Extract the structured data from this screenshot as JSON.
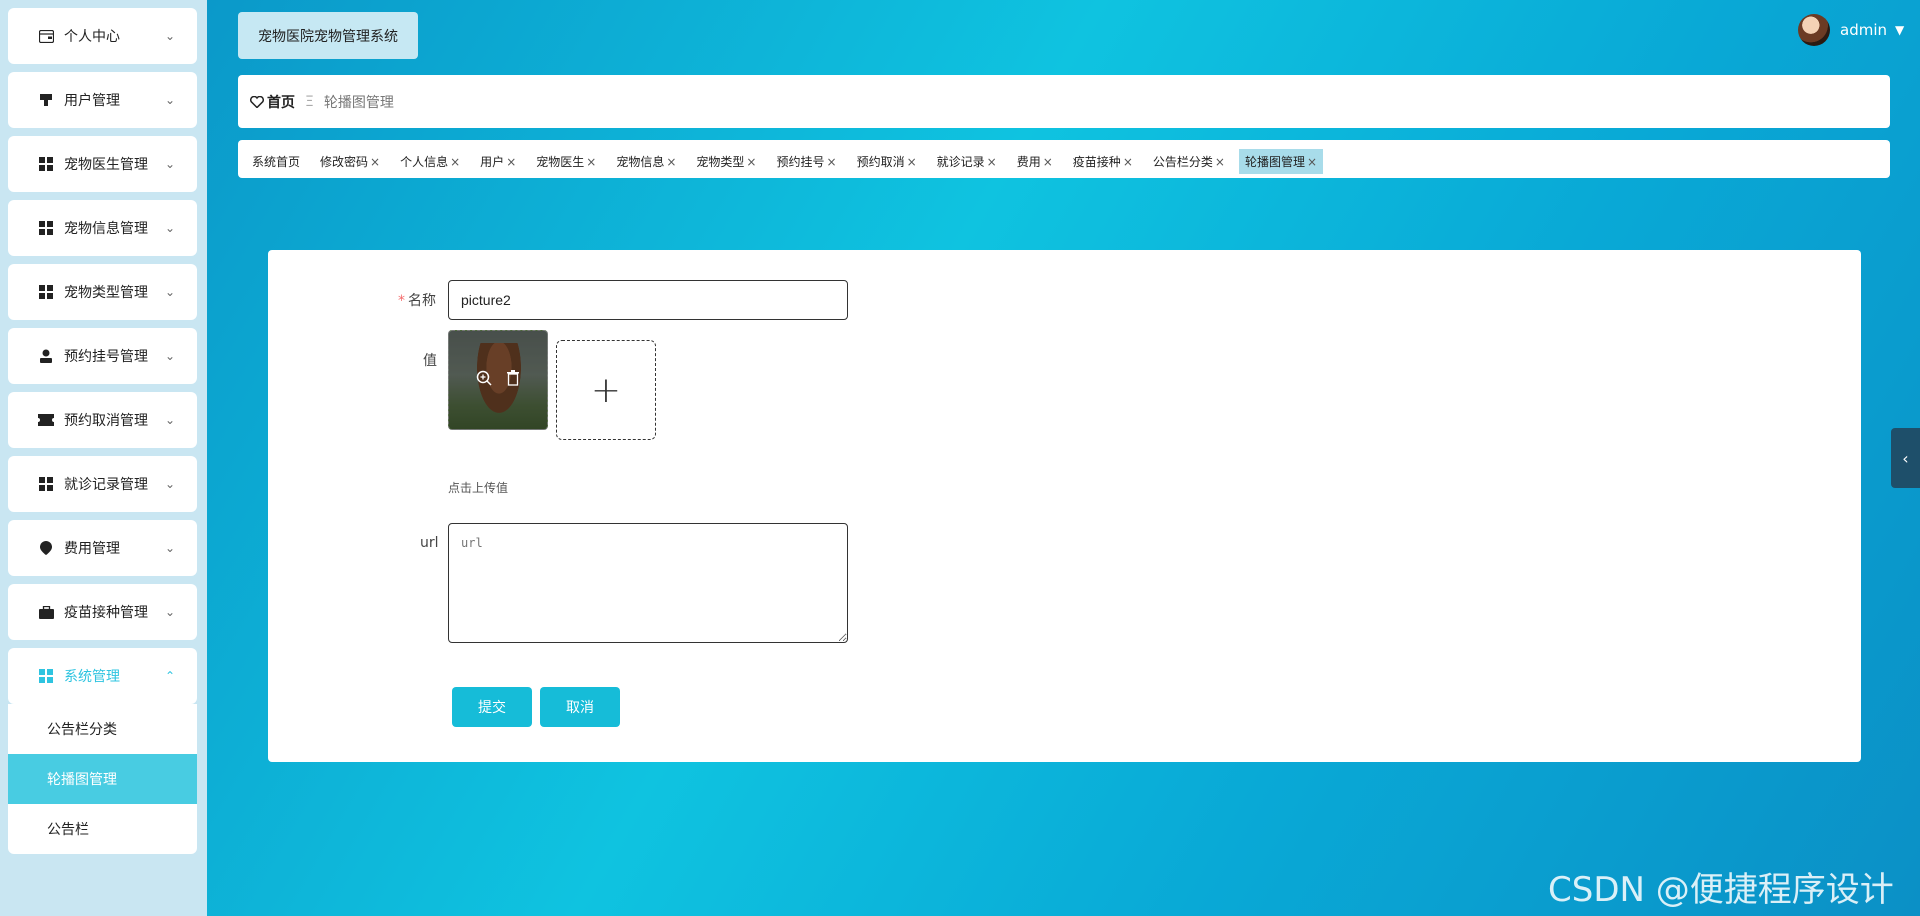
{
  "app": {
    "title": "宠物医院宠物管理系统"
  },
  "user": {
    "name": "admin",
    "caret": "▼"
  },
  "breadcrumb": {
    "home": "首页",
    "separator": "Ξ",
    "current": "轮播图管理"
  },
  "sidebar": {
    "items": [
      {
        "label": "个人中心",
        "icon": "wallet-icon"
      },
      {
        "label": "用户管理",
        "icon": "stamp-icon"
      },
      {
        "label": "宠物医生管理",
        "icon": "grid-icon"
      },
      {
        "label": "宠物信息管理",
        "icon": "grid-icon"
      },
      {
        "label": "宠物类型管理",
        "icon": "grid-icon"
      },
      {
        "label": "预约挂号管理",
        "icon": "person-icon"
      },
      {
        "label": "预约取消管理",
        "icon": "ticket-icon"
      },
      {
        "label": "就诊记录管理",
        "icon": "grid-icon"
      },
      {
        "label": "费用管理",
        "icon": "location-icon"
      },
      {
        "label": "疫苗接种管理",
        "icon": "briefcase-icon"
      },
      {
        "label": "系统管理",
        "icon": "grid-icon"
      }
    ],
    "submenu": [
      {
        "label": "公告栏分类"
      },
      {
        "label": "轮播图管理"
      },
      {
        "label": "公告栏"
      }
    ]
  },
  "tabs": [
    {
      "label": "系统首页",
      "closable": false
    },
    {
      "label": "修改密码",
      "closable": true
    },
    {
      "label": "个人信息",
      "closable": true
    },
    {
      "label": "用户",
      "closable": true
    },
    {
      "label": "宠物医生",
      "closable": true
    },
    {
      "label": "宠物信息",
      "closable": true
    },
    {
      "label": "宠物类型",
      "closable": true
    },
    {
      "label": "预约挂号",
      "closable": true
    },
    {
      "label": "预约取消",
      "closable": true
    },
    {
      "label": "就诊记录",
      "closable": true
    },
    {
      "label": "费用",
      "closable": true
    },
    {
      "label": "疫苗接种",
      "closable": true
    },
    {
      "label": "公告栏分类",
      "closable": true
    },
    {
      "label": "轮播图管理",
      "closable": true
    }
  ],
  "form": {
    "name_label": "名称",
    "name_required": "*",
    "name_value": "picture2",
    "value_label": "值",
    "upload_plus": "+",
    "upload_hint": "点击上传值",
    "url_label": "url",
    "url_placeholder": "url",
    "submit_label": "提交",
    "cancel_label": "取消"
  },
  "watermark": "CSDN @便捷程序设计",
  "colors": {
    "accent": "#16bcd8",
    "sidebar_bg": "#c9e6f2",
    "selected_sub": "#48cce2"
  }
}
